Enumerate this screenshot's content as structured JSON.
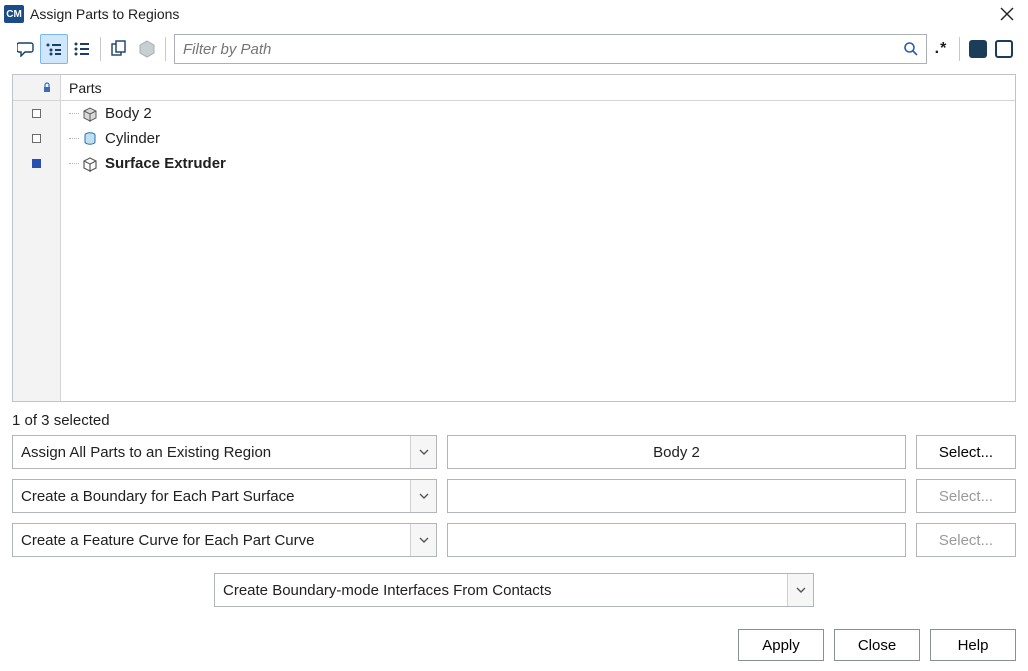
{
  "window": {
    "logo": "CM",
    "title": "Assign Parts to Regions"
  },
  "toolbar": {
    "filter_placeholder": "Filter by Path",
    "dotstar": ".*"
  },
  "tree": {
    "header": "Parts",
    "items": [
      {
        "label": "Body 2",
        "icon": "mesh-box",
        "checked": false,
        "selected": false
      },
      {
        "label": "Cylinder",
        "icon": "cylinder",
        "checked": false,
        "selected": false
      },
      {
        "label": "Surface Extruder",
        "icon": "surface-box",
        "checked": true,
        "selected": true
      }
    ]
  },
  "status": {
    "selected_text": "1 of 3 selected"
  },
  "config": {
    "assign_mode": "Assign All Parts to an Existing Region",
    "region_value": "Body 2",
    "boundary_mode": "Create a Boundary for Each Part Surface",
    "curve_mode": "Create a Feature Curve for Each Part Curve",
    "interfaces_mode": "Create Boundary-mode Interfaces From Contacts",
    "select_label": "Select..."
  },
  "footer": {
    "apply": "Apply",
    "close": "Close",
    "help": "Help"
  }
}
